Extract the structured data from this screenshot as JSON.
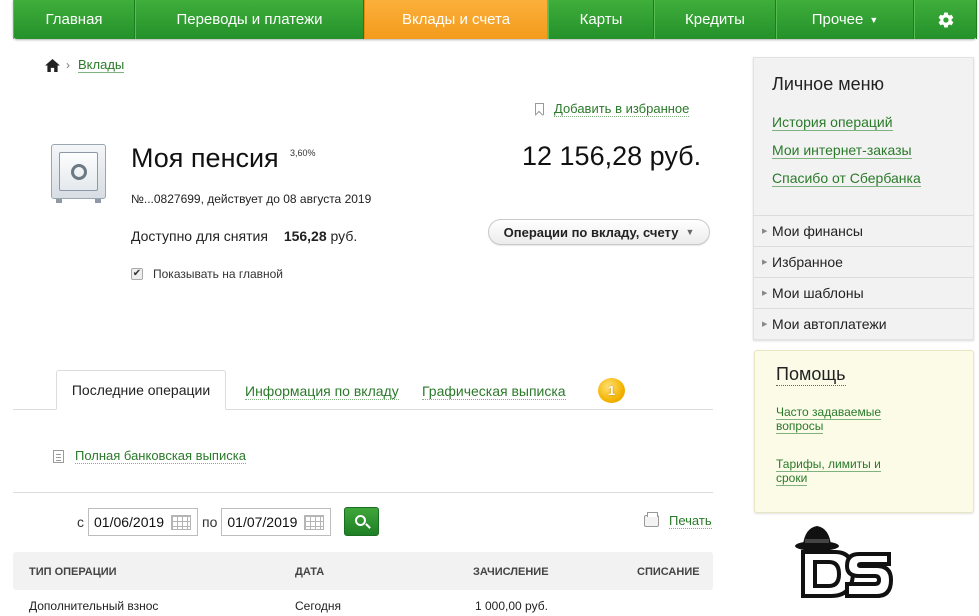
{
  "nav": {
    "items": [
      {
        "label": "Главная"
      },
      {
        "label": "Переводы и платежи"
      },
      {
        "label": "Вклады и счета"
      },
      {
        "label": "Карты"
      },
      {
        "label": "Кредиты"
      },
      {
        "label": "Прочее"
      }
    ],
    "active": "Вклады и счета"
  },
  "breadcrumb": {
    "current": "Вклады"
  },
  "favorite_link": "Добавить в избранное",
  "deposit": {
    "name": "Моя пенсия",
    "rate": "3,60%",
    "amount": "12 156,28 руб.",
    "account_info": "№...0827699, действует до 08 августа 2019",
    "available_label": "Доступно для снятия",
    "available_value": "156,28",
    "available_currency": "руб.",
    "operations_button": "Операции по вкладу, счету",
    "show_on_main": "Показывать на главной",
    "show_on_main_checked": true
  },
  "tabs": [
    {
      "label": "Последние операции",
      "active": true
    },
    {
      "label": "Информация по вкладу"
    },
    {
      "label": "Графическая выписка"
    }
  ],
  "tab_badge": "1",
  "full_statement": "Полная банковская выписка",
  "filter": {
    "from_label": "с",
    "from_value": "01/06/2019",
    "to_label": "по",
    "to_value": "01/07/2019",
    "print_label": "Печать"
  },
  "table": {
    "headers": [
      "ТИП ОПЕРАЦИИ",
      "ДАТА",
      "ЗАЧИСЛЕНИЕ",
      "СПИСАНИЕ"
    ],
    "rows": [
      {
        "type": "Дополнительный взнос",
        "date": "Сегодня",
        "credit": "1 000,00 руб.",
        "debit": ""
      }
    ]
  },
  "sidebar": {
    "title": "Личное меню",
    "links": [
      "История операций",
      "Мои интернет-заказы",
      "Спасибо от Сбербанка"
    ],
    "sections": [
      "Мои финансы",
      "Избранное",
      "Мои шаблоны",
      "Мои автоплатежи"
    ]
  },
  "help": {
    "title": "Помощь",
    "links": [
      "Часто задаваемые вопросы",
      "Тарифы, лимиты и сроки"
    ]
  },
  "logo_text": "DS",
  "colors": {
    "brand_green": "#2fa236",
    "active_orange": "#f7a52a",
    "link_green": "#2a7a2a"
  }
}
